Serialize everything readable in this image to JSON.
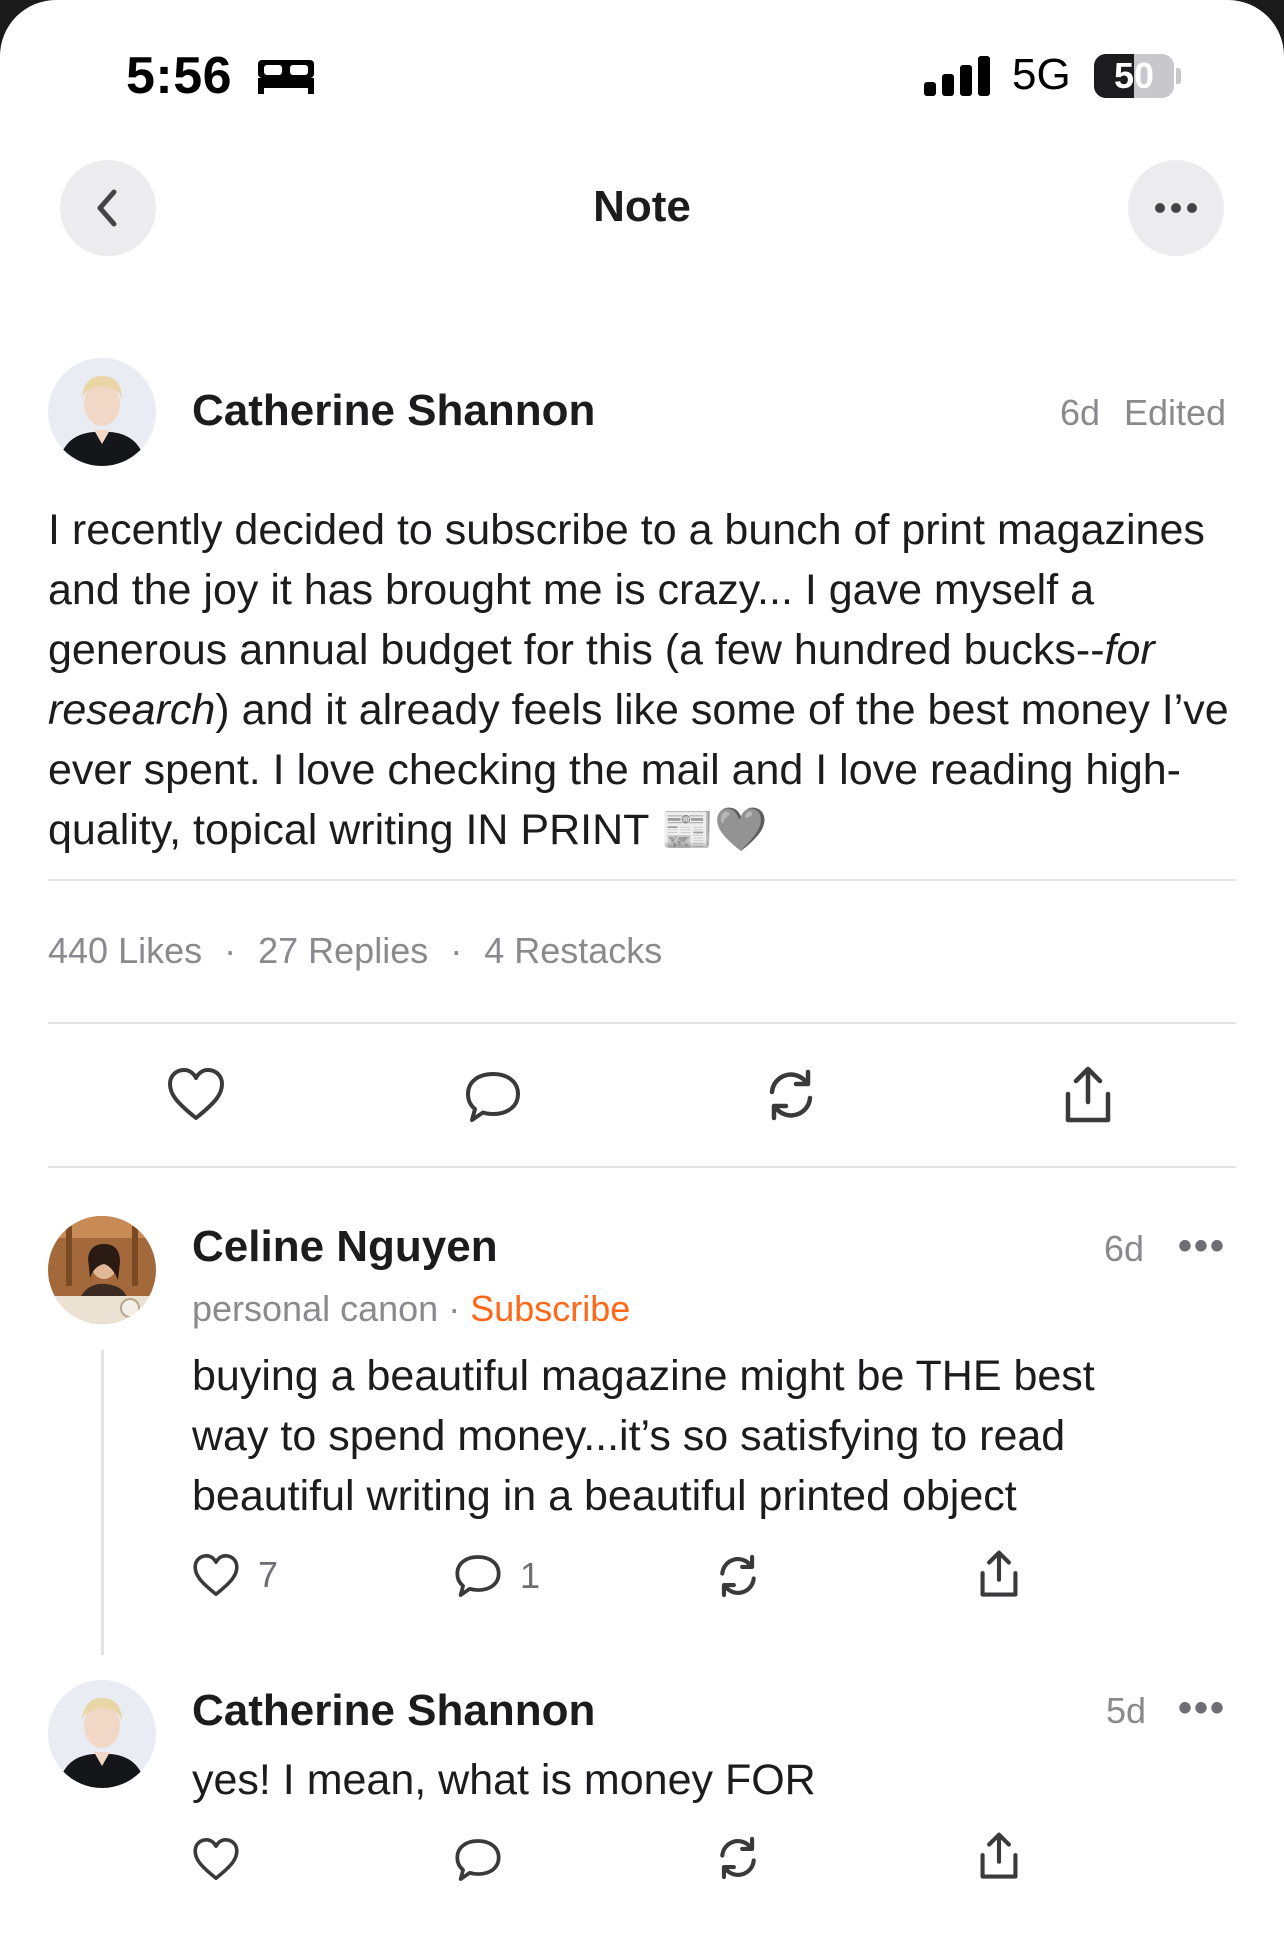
{
  "status_bar": {
    "time": "5:56",
    "network": "5G",
    "battery_level": "50",
    "battery_fraction": 0.5,
    "icons": [
      "bed-icon",
      "signal-icon",
      "battery-icon"
    ]
  },
  "nav": {
    "title": "Note",
    "back_icon": "chevron-left-icon",
    "more_icon": "ellipsis-icon"
  },
  "post": {
    "author": "Catherine Shannon",
    "age": "6d",
    "edited": "Edited",
    "body_part1": "I recently decided to subscribe to a bunch of print magazines and the joy it has brought me is crazy... I gave myself a generous annual budget for this (a few hundred bucks--",
    "body_italic": "for research",
    "body_part2": ") and it already feels like some of the best money I’ve ever spent. I love checking the mail and I love reading high-quality, topical writing IN PRINT ",
    "body_emoji": "📰🩶",
    "stats": {
      "likes": "440 Likes",
      "replies": "27 Replies",
      "restacks": "4 Restacks",
      "separator": "·"
    },
    "actions": [
      "heart-icon",
      "comment-icon",
      "restack-icon",
      "share-icon"
    ]
  },
  "replies": [
    {
      "author": "Celine Nguyen",
      "publication": "personal canon",
      "separator": "·",
      "subscribe_label": "Subscribe",
      "age": "6d",
      "more": "•••",
      "text_lines": [
        "buying a beautiful magazine might be THE best",
        "way to spend money...it’s so satisfying to read",
        "beautiful writing in a beautiful printed object"
      ],
      "like_count": "7",
      "comment_count": "1"
    },
    {
      "author": "Catherine Shannon",
      "age": "5d",
      "more": "•••",
      "text": "yes! I mean, what is money FOR"
    }
  ],
  "colors": {
    "accent": "#ff6719",
    "text": "#1c1c1e",
    "muted": "#8a8a8e",
    "divider": "#e4e4e6"
  }
}
